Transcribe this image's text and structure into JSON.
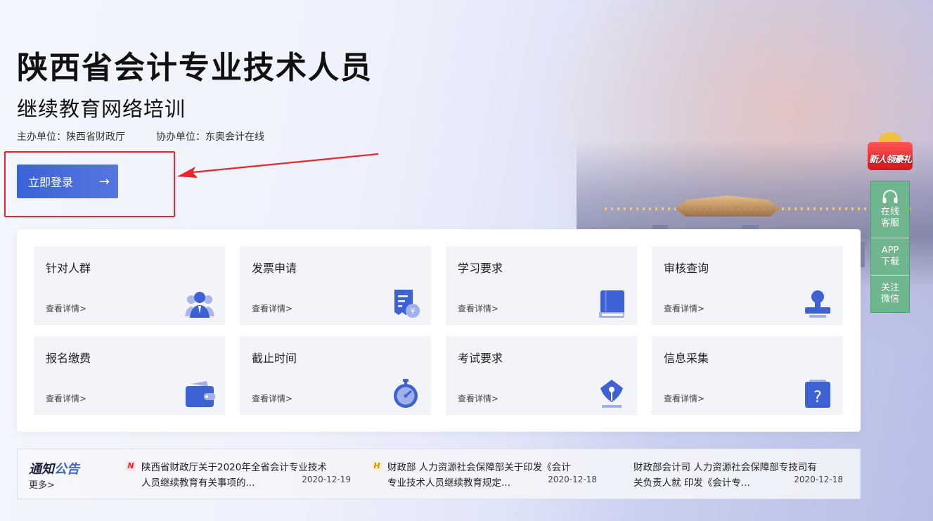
{
  "hero": {
    "title": "陕西省会计专业技术人员",
    "subtitle": "继续教育网络培训",
    "host_org": "主办单位：陕西省财政厅",
    "co_org": "协办单位：东奥会计在线",
    "login_label": "立即登录",
    "login_arrow": "→"
  },
  "tiles": [
    {
      "title": "针对人群",
      "link": "查看详情>",
      "icon": "people-icon"
    },
    {
      "title": "发票申请",
      "link": "查看详情>",
      "icon": "invoice-icon"
    },
    {
      "title": "学习要求",
      "link": "查看详情>",
      "icon": "book-icon"
    },
    {
      "title": "审核查询",
      "link": "查看详情>",
      "icon": "stamp-icon"
    },
    {
      "title": "报名缴费",
      "link": "查看详情>",
      "icon": "wallet-icon"
    },
    {
      "title": "截止时间",
      "link": "查看详情>",
      "icon": "stopwatch-icon"
    },
    {
      "title": "考试要求",
      "link": "查看详情>",
      "icon": "pen-nib-icon"
    },
    {
      "title": "信息采集",
      "link": "查看详情>",
      "icon": "question-icon"
    }
  ],
  "side": {
    "promo": "新人领豪礼",
    "service_1": "在线",
    "service_2": "客服",
    "app_1": "APP",
    "app_2": "下载",
    "wechat_1": "关注",
    "wechat_2": "微信"
  },
  "notice": {
    "brand_a": "通知",
    "brand_b": "公告",
    "more": "更多>",
    "items": [
      {
        "tag": "N",
        "line1": "陕西省财政厅关于2020年全省会计专业技术",
        "line2": "人员继续教育有关事项的...",
        "date": "2020-12-19"
      },
      {
        "tag": "H",
        "line1": "财政部 人力资源社会保障部关于印发《会计",
        "line2": "专业技术人员继续教育规定...",
        "date": "2020-12-18"
      },
      {
        "tag": "",
        "line1": "财政部会计司 人力资源社会保障部专技司有",
        "line2": "关负责人就 印发《会计专...",
        "date": "2020-12-18"
      }
    ]
  },
  "colors": {
    "accent": "#3b63d6",
    "highlight_red": "#e8262b",
    "side_green": "#6fb58e",
    "tile_bg": "#f2f4fa"
  }
}
